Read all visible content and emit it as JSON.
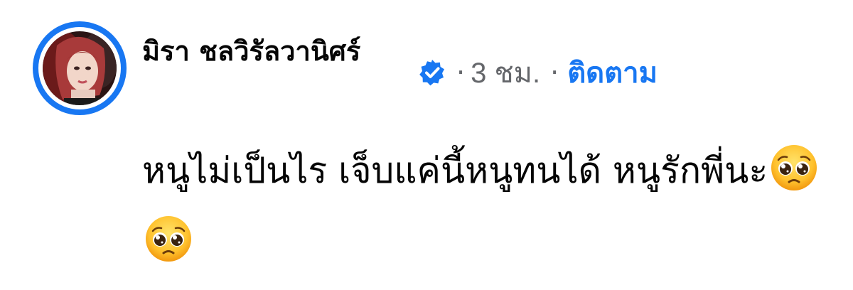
{
  "comment": {
    "author": "มิรา ชลวิรัลวานิศร์",
    "verified_icon": "verified-badge-icon",
    "separator": "·",
    "timestamp": "3 ชม.",
    "follow_label": "ติดตาม",
    "text": "หนูไม่เป็นไร เจ็บแค่นี้หนูทนได้ หนูรักพี่นะ",
    "emojis": [
      "pleading-face-emoji",
      "pleading-face-emoji"
    ]
  },
  "colors": {
    "accent": "#1877f2",
    "meta_text": "#65676b",
    "text": "#050505"
  }
}
